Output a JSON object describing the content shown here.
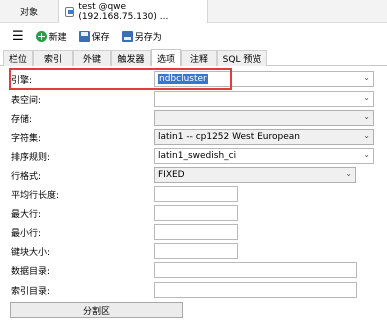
{
  "tabs": {
    "objects": "对象",
    "connection": "test @qwe (192.168.75.130) ..."
  },
  "toolbar": {
    "menu_icon": "☰",
    "new_label": "新建",
    "save_label": "保存",
    "saveas_label": "另存为"
  },
  "subtabs": [
    "栏位",
    "索引",
    "外键",
    "触发器",
    "选项",
    "注释",
    "SQL 预览"
  ],
  "active_subtab": "选项",
  "form": {
    "engine": {
      "label": "引擎:",
      "value": "ndbcluster"
    },
    "tablespace": {
      "label": "表空间:",
      "value": ""
    },
    "storage": {
      "label": "存储:",
      "value": ""
    },
    "charset": {
      "label": "字符集:",
      "value": "latin1 -- cp1252 West European"
    },
    "collation": {
      "label": "排序规则:",
      "value": "latin1_swedish_ci"
    },
    "row_format": {
      "label": "行格式:",
      "value": "FIXED"
    },
    "avg_row_length": {
      "label": "平均行长度:",
      "value": ""
    },
    "max_rows": {
      "label": "最大行:",
      "value": ""
    },
    "min_rows": {
      "label": "最小行:",
      "value": ""
    },
    "key_block_size": {
      "label": "键块大小:",
      "value": ""
    },
    "data_directory": {
      "label": "数据目录:",
      "value": ""
    },
    "index_directory": {
      "label": "索引目录:",
      "value": ""
    }
  },
  "partition_button": "分割区",
  "colors": {
    "highlight": "#e53b3b",
    "selection": "#3476d2"
  }
}
